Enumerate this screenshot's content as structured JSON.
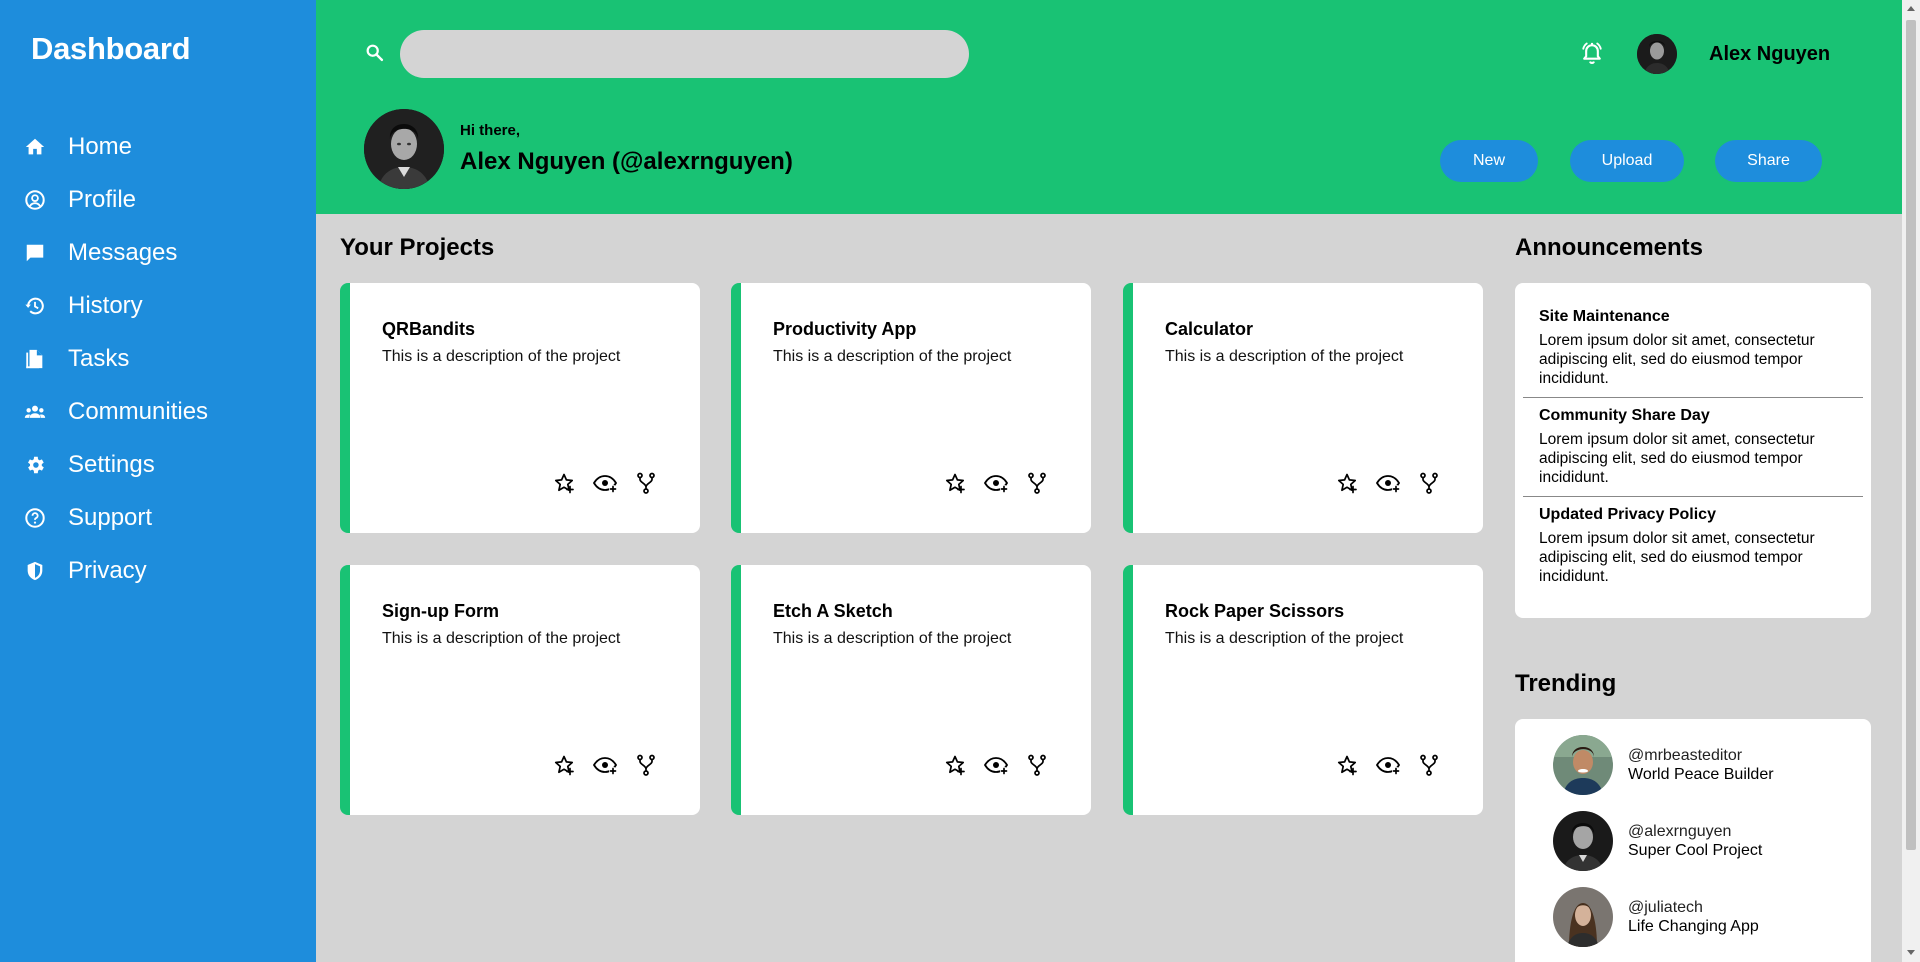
{
  "sidebar": {
    "brand": "Dashboard",
    "items": [
      {
        "label": "Home",
        "icon": "home-icon"
      },
      {
        "label": "Profile",
        "icon": "profile-icon"
      },
      {
        "label": "Messages",
        "icon": "messages-icon"
      },
      {
        "label": "History",
        "icon": "history-icon"
      },
      {
        "label": "Tasks",
        "icon": "tasks-icon"
      },
      {
        "label": "Communities",
        "icon": "communities-icon"
      },
      {
        "label": "Settings",
        "icon": "gear-icon"
      },
      {
        "label": "Support",
        "icon": "help-icon"
      },
      {
        "label": "Privacy",
        "icon": "shield-icon"
      }
    ]
  },
  "header": {
    "search_placeholder": "",
    "username": "Alex Nguyen",
    "greeting": "Hi there,",
    "display_name": "Alex Nguyen (@alexrnguyen)",
    "buttons": {
      "new": "New",
      "upload": "Upload",
      "share": "Share"
    }
  },
  "projects": {
    "title": "Your Projects",
    "items": [
      {
        "title": "QRBandits",
        "description": "This is a description of the project"
      },
      {
        "title": "Productivity App",
        "description": "This is a description of the project"
      },
      {
        "title": "Calculator",
        "description": "This is a description of the project"
      },
      {
        "title": "Sign-up Form",
        "description": "This is a description of the project"
      },
      {
        "title": "Etch A Sketch",
        "description": "This is a description of the project"
      },
      {
        "title": "Rock Paper Scissors",
        "description": "This is a description of the project"
      }
    ]
  },
  "announcements": {
    "title": "Announcements",
    "items": [
      {
        "title": "Site Maintenance",
        "text": "Lorem ipsum dolor sit amet, consectetur adipiscing elit, sed do eiusmod tempor incididunt."
      },
      {
        "title": "Community Share Day",
        "text": "Lorem ipsum dolor sit amet, consectetur adipiscing elit, sed do eiusmod tempor incididunt."
      },
      {
        "title": "Updated Privacy Policy",
        "text": "Lorem ipsum dolor sit amet, consectetur adipiscing elit, sed do eiusmod tempor incididunt."
      }
    ]
  },
  "trending": {
    "title": "Trending",
    "items": [
      {
        "handle": "@mrbeasteditor",
        "project": "World Peace Builder"
      },
      {
        "handle": "@alexrnguyen",
        "project": "Super Cool Project"
      },
      {
        "handle": "@juliatech",
        "project": "Life Changing App"
      }
    ]
  },
  "colors": {
    "sidebar": "#1e8ddc",
    "header": "#19c274",
    "background": "#d4d4d4",
    "button": "#1e8ddc",
    "card_accent": "#19c274"
  }
}
